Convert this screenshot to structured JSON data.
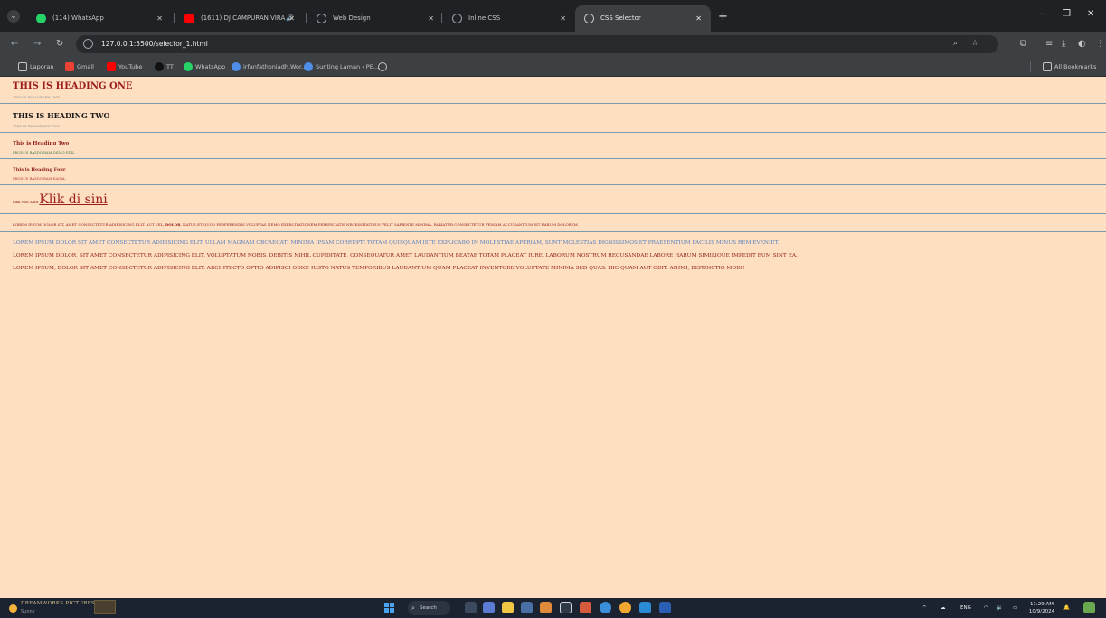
{
  "tabs": [
    {
      "title": "(114) WhatsApp",
      "icon": "whatsapp-icon",
      "color": "#25d366"
    },
    {
      "title": "(1611) DJ CAMPURAN VIRA",
      "icon": "youtube-icon",
      "color": "#ff0000",
      "audio": "🔊"
    },
    {
      "title": "Web Design",
      "icon": "globe-icon",
      "color": "#9aa0a6"
    },
    {
      "title": "Inline CSS",
      "icon": "globe-icon",
      "color": "#9aa0a6"
    },
    {
      "title": "CSS Selector",
      "icon": "globe-icon",
      "color": "#9aa0a6"
    }
  ],
  "toolbar": {
    "url": "127.0.0.1:5500/selector_1.html"
  },
  "bookmarks": [
    {
      "label": "Laporan",
      "icon": "folder-icon",
      "color": "#c4c7c5"
    },
    {
      "label": "Gmail",
      "icon": "gmail-icon",
      "color": "#ea4335"
    },
    {
      "label": "YouTube",
      "icon": "youtube-icon",
      "color": "#ff0000"
    },
    {
      "label": "TT",
      "icon": "tiktok-icon",
      "color": "#111111"
    },
    {
      "label": "WhatsApp",
      "icon": "whatsapp-icon",
      "color": "#25d366"
    },
    {
      "label": "irfanfathoniadh.Wor...",
      "icon": "wordpress-icon",
      "color": "#4f8ee8"
    },
    {
      "label": "Sunting Laman ‹ PE...",
      "icon": "wordpress-icon",
      "color": "#4f8ee8"
    }
  ],
  "all_bookmarks": "All Bookmarks",
  "page": {
    "heading_one": "THIS IS HEADING ONE",
    "paragraph_one": "THIS IS PARAGRAPH ONE",
    "heading_two": "THIS IS HEADING TWO",
    "paragraph_two": "THIS IS PARAGRAPH TWO",
    "heading_three": "This is Heading Two",
    "paragraph_three": "PRODUS BASDO RAM DEMO EDIL",
    "heading_four": "This is Heading Four",
    "paragraph_four": "PRODUS BASDO RAM EAGAL",
    "link_prefix": "Link Non Aktif",
    "link_text": "Klik di sini",
    "lorem_small_pre": "LOREM IPSUM DOLOR SIT, AMET CONSECTETUR ADIPISICING ELIT. AUT VEL, ",
    "lorem_small_bold": "DOLOR",
    "lorem_small_post": ", NATUS ET QUOD PERFERENDIS VOLUPTAS NEMO EXERCITATIONEM PERSPICIATIS NECESSITATIBUS VELIT SAPIENTE MINIMA. PARIATUR CONSECTETUR VENIAM ACCUSANTIUM SIT EARUM DOLOREM.",
    "lorem_blue": "LOREM IPSUM DOLOR SIT AMET CONSECTETUR ADIPISICING ELIT. ULLAM MAGNAM OBCAECATI MINIMA IPSAM CORRUPTI TOTAM QUISQUAM ISTE EXPLICABO IN MOLESTIAE APERIAM, SUNT MOLESTIAS DIGNISSIMOS ET PRAESENTIUM FACILIS MINUS REM EVENIET.",
    "lorem_red_1": "LOREM IPSUM DOLOR, SIT AMET CONSECTETUR ADIPISICING ELIT. VOLUPTATUM NOBIS, DEBITIS NIHIL CUPIDITATE, CONSEQUATUR AMET LAUDANTIUM BEATAE TOTAM PLACEAT IURE, LABORUM NOSTRUM RECUSANDAE LABORE HARUM SIMILIQUE IMPEDIT EUM SINT EA.",
    "lorem_red_2": "LOREM IPSUM, DOLOR SIT AMET CONSECTETUR ADIPISICING ELIT. ARCHITECTO OPTIO ADIPISCI ODIO! IUSTO NATUS TEMPORIBUS LAUDANTIUM QUAM PLACEAT INVENTORE VOLUPTATE MINIMA SED QUAS. HIC QUAM AUT ODIT. ANIMI, DISTINCTIO MODI!"
  },
  "taskbar": {
    "weather_title": "DREAMWORKS PICTURES",
    "weather_status": "Sunny",
    "search_label": "Search",
    "language": "ENG",
    "time": "11:29 AM",
    "date": "10/9/2024"
  },
  "colors": {
    "page_bg": "#ffdfc1",
    "heading_red": "#9c1d1d",
    "blue_text": "#4f7fbf",
    "divider": "#7a9ab0"
  }
}
